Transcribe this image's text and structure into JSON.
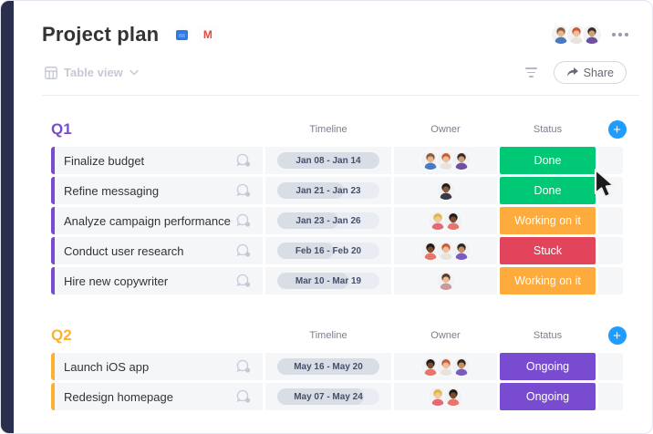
{
  "header": {
    "title": "Project plan",
    "integration_icons": [
      "board-icon",
      "gmail-icon"
    ]
  },
  "toolbar": {
    "view_label": "Table view",
    "share_label": "Share"
  },
  "columns": [
    "Timeline",
    "Owner",
    "Status"
  ],
  "colors": {
    "sidebar_navy": "#292f4c",
    "add_button_blue": "#1f9cff",
    "done_green": "#00c875",
    "working_orange": "#fdab3d",
    "stuck_red": "#e2445c",
    "ongoing_purple": "#784bd1",
    "q1_group": "#784bd1",
    "q2_group": "#fcb12f"
  },
  "team_avatars": [
    {
      "hair": "#8a5a3b",
      "skin": "#e8b48e",
      "shirt": "#4a79c4"
    },
    {
      "hair": "#c75d35",
      "skin": "#f0bf9a",
      "shirt": "#e9e3dd"
    },
    {
      "hair": "#3f2a25",
      "skin": "#caa07a",
      "shirt": "#6e4fa1"
    }
  ],
  "groups": [
    {
      "label": "Q1",
      "color": "#784bd1",
      "rows": [
        {
          "task": "Finalize budget",
          "timeline": "Jan 08 - Jan 14",
          "progress": 1,
          "status": "Done",
          "status_color": "#00c875",
          "owners": [
            {
              "hair": "#8a5a3b",
              "skin": "#e8b48e",
              "shirt": "#4a79c4"
            },
            {
              "hair": "#c75d35",
              "skin": "#f0bf9a",
              "shirt": "#e9e3dd"
            },
            {
              "hair": "#3f2a25",
              "skin": "#caa07a",
              "shirt": "#6e4fa1"
            }
          ]
        },
        {
          "task": "Refine messaging",
          "timeline": "Jan 21 - Jan 23",
          "progress": 0.65,
          "status": "Done",
          "status_color": "#00c875",
          "owners": [
            {
              "hair": "#241d1b",
              "skin": "#8d5a3c",
              "shirt": "#3c3a45"
            }
          ]
        },
        {
          "task": "Analyze campaign performance",
          "timeline": "Jan 23 - Jan 26",
          "progress": 0.6,
          "status": "Working on it",
          "status_color": "#fdab3d",
          "owners": [
            {
              "hair": "#e3b53e",
              "skin": "#f0c79e",
              "shirt": "#e46a74"
            },
            {
              "hair": "#1f1a18",
              "skin": "#7c4a2d",
              "shirt": "#e8746a"
            }
          ]
        },
        {
          "task": "Conduct user research",
          "timeline": "Feb 16 - Feb 20",
          "progress": 0.55,
          "status": "Stuck",
          "status_color": "#e2445c",
          "owners": [
            {
              "hair": "#1f1a18",
              "skin": "#7c4a2d",
              "shirt": "#e8746a"
            },
            {
              "hair": "#c75d35",
              "skin": "#f0bf9a",
              "shirt": "#e9e3dd"
            },
            {
              "hair": "#2e2620",
              "skin": "#c68e5f",
              "shirt": "#7a5bc0"
            }
          ]
        },
        {
          "task": "Hire new copywriter",
          "timeline": "Mar 10 - Mar 19",
          "progress": 0.7,
          "status": "Working on it",
          "status_color": "#fdab3d",
          "owners": [
            {
              "hair": "#5a3a28",
              "skin": "#edbd96",
              "shirt": "#cc9999"
            }
          ]
        }
      ]
    },
    {
      "label": "Q2",
      "color": "#fcb12f",
      "rows": [
        {
          "task": "Launch iOS app",
          "timeline": "May 16 - May 20",
          "progress": 1,
          "status": "Ongoing",
          "status_color": "#784bd1",
          "owners": [
            {
              "hair": "#1f1a18",
              "skin": "#7c4a2d",
              "shirt": "#e8746a"
            },
            {
              "hair": "#c75d35",
              "skin": "#f0bf9a",
              "shirt": "#e9e3dd"
            },
            {
              "hair": "#2e2620",
              "skin": "#c68e5f",
              "shirt": "#7a5bc0"
            }
          ]
        },
        {
          "task": "Redesign homepage",
          "timeline": "May 07 - May 24",
          "progress": 0.85,
          "status": "Ongoing",
          "status_color": "#784bd1",
          "owners": [
            {
              "hair": "#e3b53e",
              "skin": "#f0c79e",
              "shirt": "#e46a74"
            },
            {
              "hair": "#1f1a18",
              "skin": "#7c4a2d",
              "shirt": "#e8746a"
            }
          ]
        }
      ]
    }
  ]
}
